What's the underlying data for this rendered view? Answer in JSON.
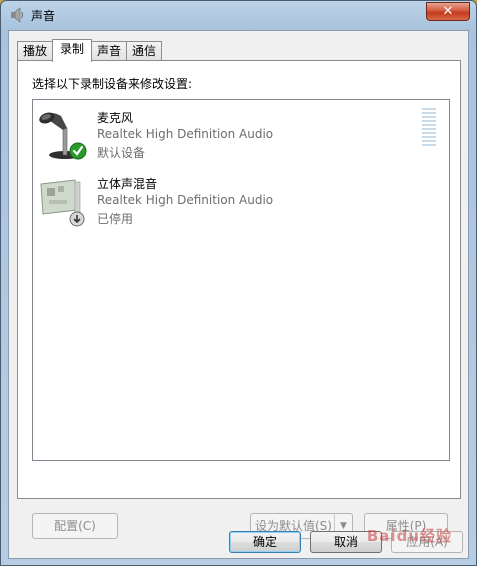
{
  "window": {
    "title": "声音",
    "close_glyph": "✕"
  },
  "tabs": [
    {
      "label": "播放",
      "active": false
    },
    {
      "label": "录制",
      "active": true
    },
    {
      "label": "声音",
      "active": false
    },
    {
      "label": "通信",
      "active": false
    }
  ],
  "panel": {
    "instruction": "选择以下录制设备来修改设置:",
    "devices": [
      {
        "name": "麦克风",
        "driver": "Realtek High Definition Audio",
        "status": "默认设备",
        "icon": "microphone-icon",
        "badge": "check-badge-icon"
      },
      {
        "name": "立体声混音",
        "driver": "Realtek High Definition Audio",
        "status": "已停用",
        "icon": "sound-card-icon",
        "badge": "disabled-badge-icon"
      }
    ],
    "buttons": {
      "configure": "配置(C)",
      "set_default": "设为默认值(S)",
      "set_default_arrow": "▼",
      "properties": "属性(P)"
    }
  },
  "footer": {
    "ok": "确定",
    "cancel": "取消",
    "apply": "应用(A)"
  },
  "watermark": "Baidu经验",
  "colors": {
    "accent": "#3c7fb1",
    "status_gray": "#6d6d6d",
    "close": "#c23a1c"
  }
}
